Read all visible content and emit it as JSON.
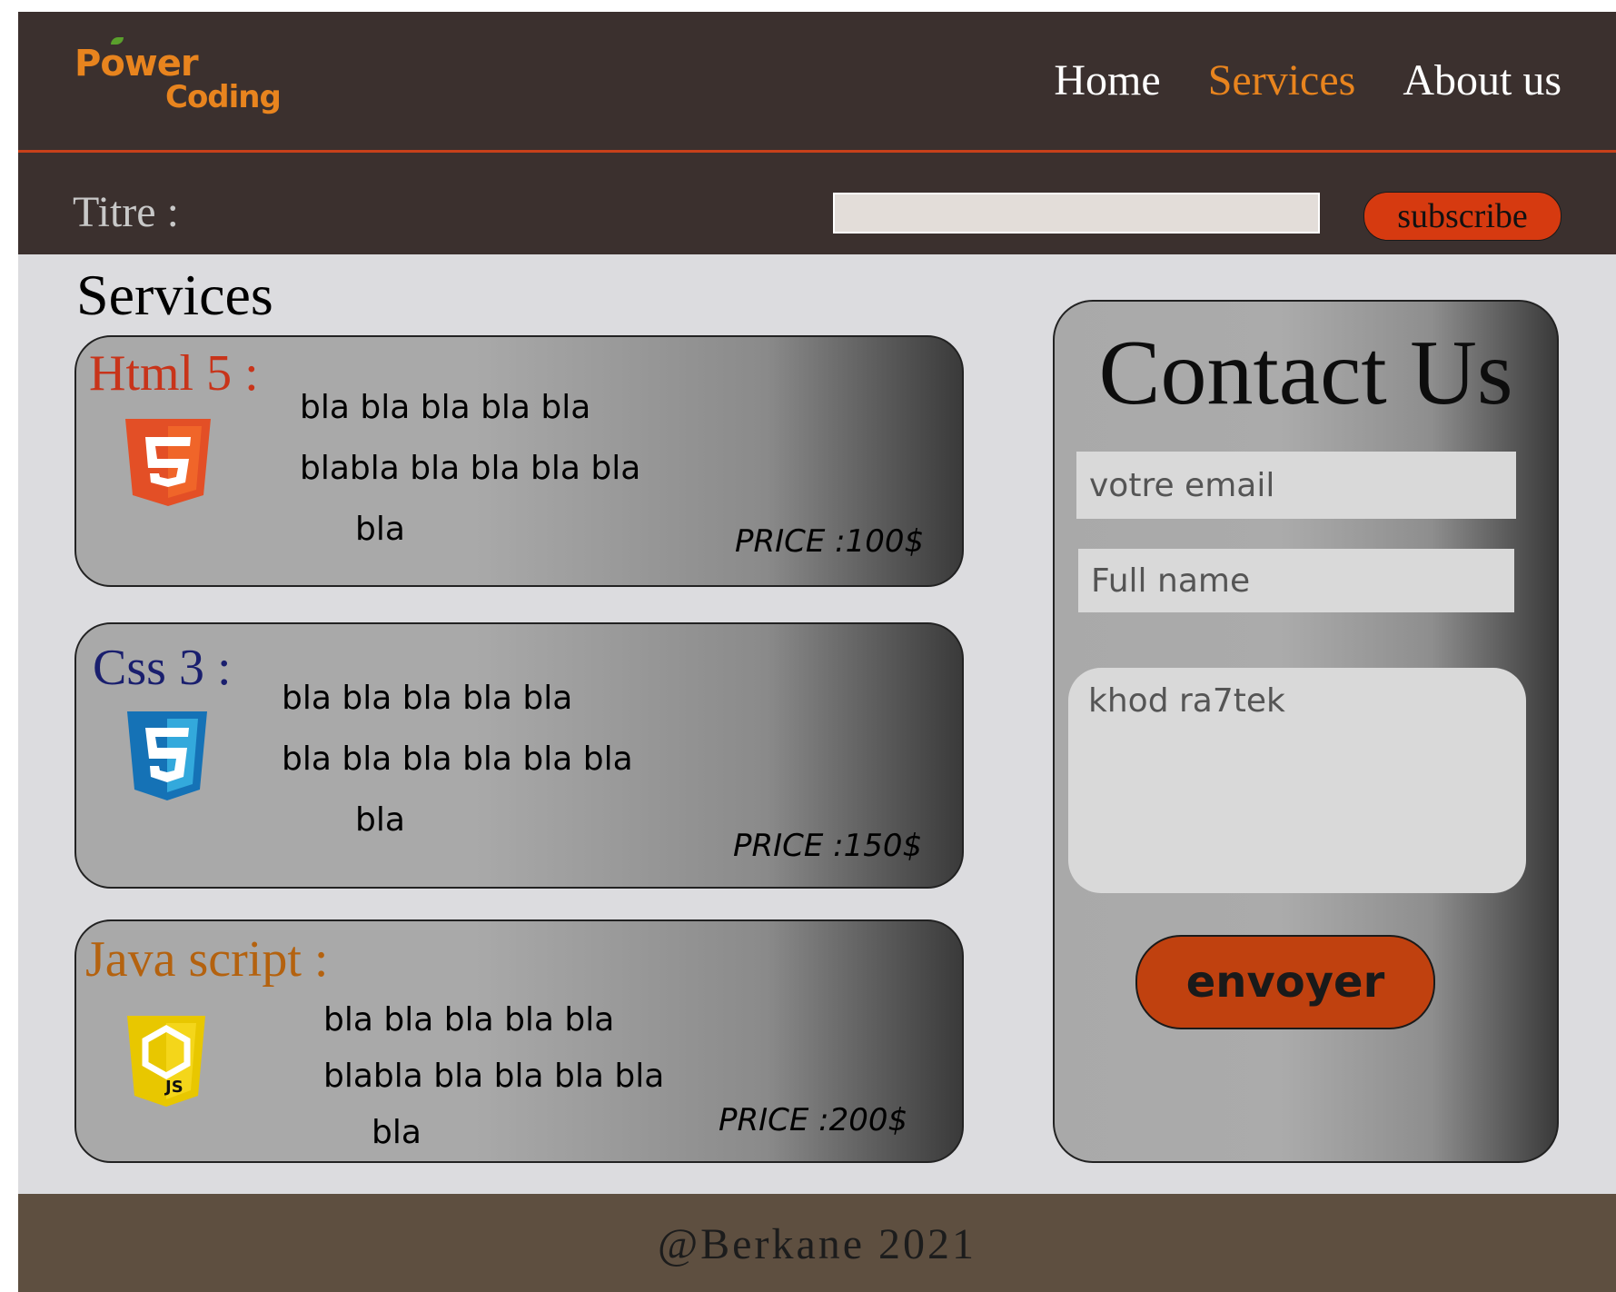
{
  "header": {
    "logo": {
      "word1": "Power",
      "word2": "Coding"
    },
    "nav": [
      {
        "label": "Home",
        "active": false
      },
      {
        "label": "Services",
        "active": true
      },
      {
        "label": "About us",
        "active": false
      }
    ]
  },
  "subscribe_bar": {
    "title_label": "Titre :",
    "input_value": "",
    "button_label": "subscribe"
  },
  "services": {
    "heading": "Services",
    "cards": [
      {
        "title": "Html 5 :",
        "title_color": "#c8341a",
        "icon": "html5-icon",
        "icon_color": "#e34f26",
        "lines": [
          "bla bla bla bla bla",
          "blabla bla bla bla bla",
          "bla"
        ],
        "price": "PRICE :100$"
      },
      {
        "title": "Css 3 :",
        "title_color": "#1a1f6e",
        "icon": "css3-icon",
        "icon_color": "#1572b6",
        "lines": [
          "bla bla bla bla bla",
          "bla  bla bla bla bla bla",
          "bla"
        ],
        "price": "PRICE :150$"
      },
      {
        "title": "Java script :",
        "title_color": "#b4620f",
        "icon": "javascript-icon",
        "icon_color": "#e8c700",
        "lines": [
          "bla bla bla bla bla",
          "blabla bla bla bla bla",
          "bla"
        ],
        "price": "PRICE :200$"
      }
    ]
  },
  "contact": {
    "title": "Contact Us",
    "email_placeholder": "votre email",
    "name_placeholder": "Full name",
    "message_placeholder": "khod ra7tek",
    "submit_label": "envoyer"
  },
  "footer": {
    "text": "@Berkane 2021"
  },
  "colors": {
    "header_bg": "#3b302e",
    "accent_orange": "#e8841e",
    "button_red": "#d63a10",
    "content_bg": "#dcdcdf",
    "footer_bg": "#5e4f40"
  }
}
